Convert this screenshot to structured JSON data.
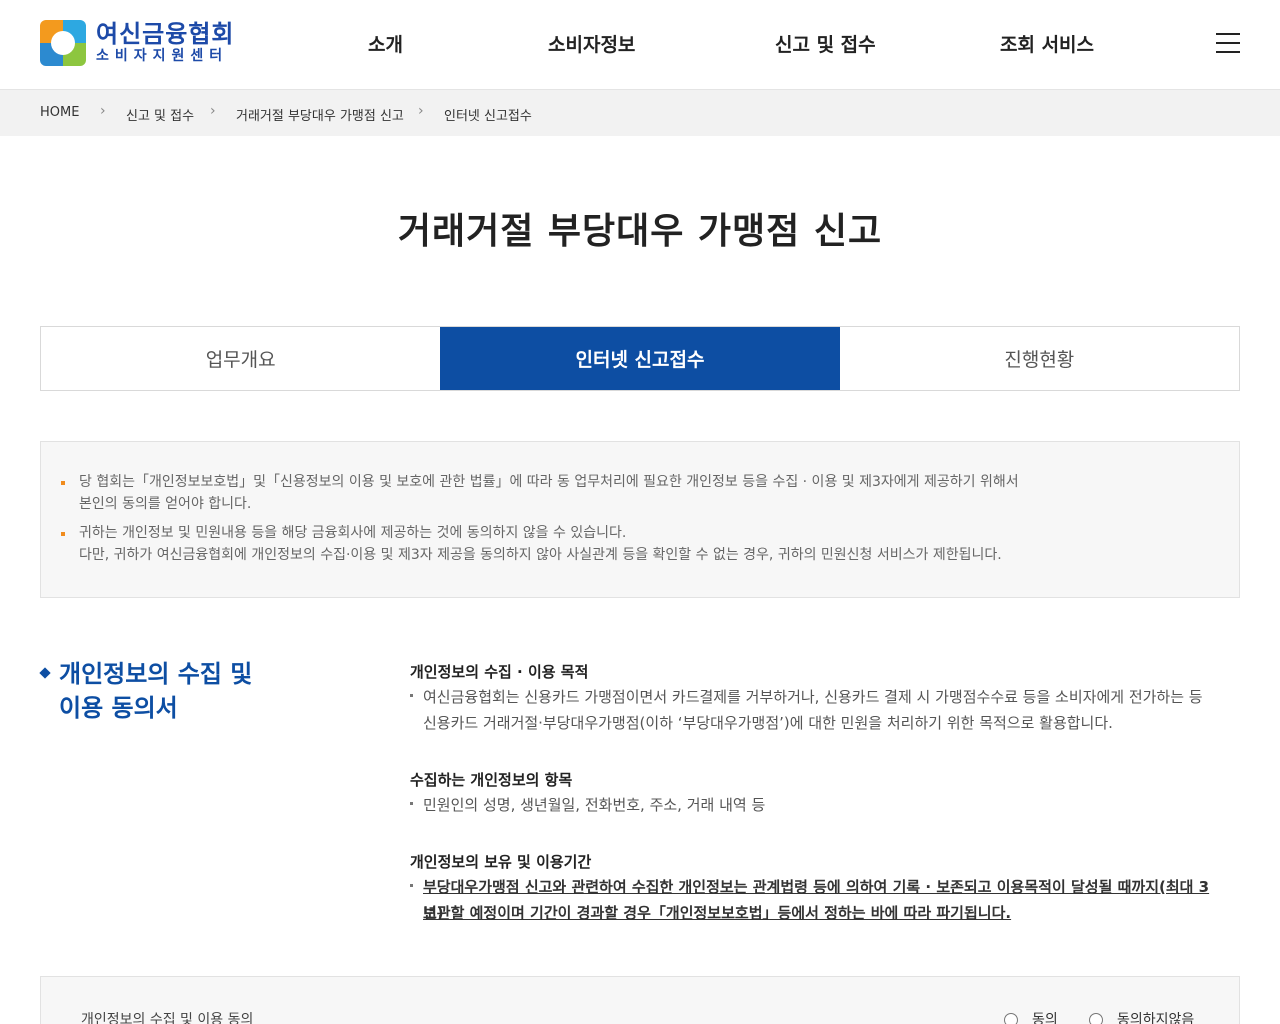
{
  "header": {
    "logo_title": "여신금융협회",
    "logo_sub": "소비자지원센터",
    "nav": [
      "소개",
      "소비자정보",
      "신고 및 접수",
      "조회 서비스"
    ]
  },
  "breadcrumb": [
    "HOME",
    "신고 및 접수",
    "거래거절 부당대우 가맹점 신고",
    "인터넷 신고접수"
  ],
  "page_title": "거래거절 부당대우 가맹점 신고",
  "tabs": [
    {
      "label": "업무개요"
    },
    {
      "label": "인터넷 신고접수"
    },
    {
      "label": "진행현황"
    }
  ],
  "notice": {
    "item1_line1": "당 협회는「개인정보보호법」및「신용정보의 이용 및 보호에 관한 법률」에 따라 동 업무처리에 필요한 개인정보 등을 수집 · 이용 및 제3자에게 제공하기 위해서",
    "item1_line2": "본인의 동의를 얻어야 합니다.",
    "item2_line1": "귀하는 개인정보 및 민원내용 등을 해당 금융회사에 제공하는 것에 동의하지 않을 수 있습니다.",
    "item2_line2": "다만, 귀하가 여신금융협회에 개인정보의 수집·이용 및 제3자 제공을 동의하지 않아 사실관계 등을 확인할 수 없는 경우, 귀하의 민원신청 서비스가 제한됩니다."
  },
  "section": {
    "title_line1": "개인정보의 수집 및",
    "title_line2": "이용 동의서",
    "purpose_heading": "개인정보의 수집 · 이용 목적",
    "purpose_line1": "여신금융협회는 신용카드 가맹점이면서 카드결제를 거부하거나, 신용카드 결제 시 가맹점수수료 등을 소비자에게 전가하는 등",
    "purpose_line2": "신용카드 거래거절·부당대우가맹점(이하 ‘부당대우가맹점’)에 대한 민원을 처리하기 위한 목적으로 활용합니다.",
    "items_heading": "수집하는 개인정보의 항목",
    "items_line": "민원인의 성명, 생년월일, 전화번호, 주소, 거래 내역 등",
    "period_heading": "개인정보의 보유 및 이용기간",
    "period_line1": "부당대우가맹점 신고와 관련하여 수집한 개인정보는 관계법령 등에 의하여 기록 · 보존되고 이용목적이 달성될 때까지(최대 3년)",
    "period_line2": "보관할 예정이며 기간이 경과할 경우「개인정보보호법」등에서 정하는 바에 따라 파기됩니다."
  },
  "agree": {
    "label": "개인정보의 수집 및 이용 동의",
    "yes": "동의",
    "no": "동의하지않음"
  }
}
